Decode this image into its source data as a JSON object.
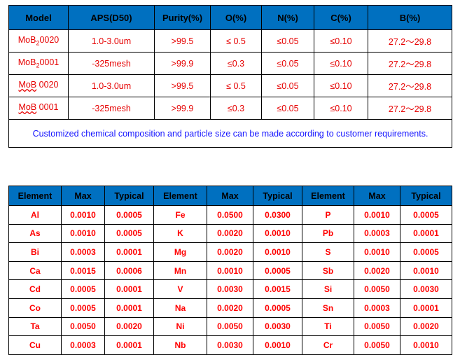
{
  "colors": {
    "header_blue": "#0070C0",
    "data_red": "#FF0000",
    "note_blue": "#1414FF",
    "border": "#000000"
  },
  "spec_table": {
    "name": "product-specification-table",
    "columns": [
      "Model",
      "APS(D50)",
      "Purity(%)",
      "O(%)",
      "N(%)",
      "C(%)",
      "B(%)"
    ],
    "rows": [
      {
        "model_prefix": "MoB",
        "model_sub": "2",
        "model_suffix": "0020",
        "model_misspelled": false,
        "aps": "1.0-3.0um",
        "purity": ">99.5",
        "o": "≤ 0.5",
        "n": "≤0.05",
        "c": "≤0.10",
        "b": "27.2～29.8"
      },
      {
        "model_prefix": "MoB",
        "model_sub": "2",
        "model_suffix": "0001",
        "model_misspelled": false,
        "aps": "-325mesh",
        "purity": ">99.9",
        "o": "≤0.3",
        "n": "≤0.05",
        "c": "≤0.10",
        "b": "27.2～29.8"
      },
      {
        "model_prefix": "MoB",
        "model_sub": "",
        "model_suffix": " 0020",
        "model_misspelled": true,
        "aps": "1.0-3.0um",
        "purity": ">99.5",
        "o": "≤ 0.5",
        "n": "≤0.05",
        "c": "≤0.10",
        "b": "27.2～29.8"
      },
      {
        "model_prefix": "MoB",
        "model_sub": "",
        "model_suffix": " 0001",
        "model_misspelled": true,
        "aps": "-325mesh",
        "purity": ">99.9",
        "o": "≤0.3",
        "n": "≤0.05",
        "c": "≤0.10",
        "b": "27.2～29.8"
      }
    ],
    "note": "Customized chemical composition and particle size can be made according to customer requirements."
  },
  "impurity_table": {
    "name": "impurity-analysis-table",
    "columns": [
      "Element",
      "Max",
      "Typical",
      "Element",
      "Max",
      "Typical",
      "Element",
      "Max",
      "Typical"
    ],
    "rows": [
      [
        "Al",
        "0.0010",
        "0.0005",
        "Fe",
        "0.0500",
        "0.0300",
        "P",
        "0.0010",
        "0.0005"
      ],
      [
        "As",
        "0.0010",
        "0.0005",
        "K",
        "0.0020",
        "0.0010",
        "Pb",
        "0.0003",
        "0.0001"
      ],
      [
        "Bi",
        "0.0003",
        "0.0001",
        "Mg",
        "0.0020",
        "0.0010",
        "S",
        "0.0010",
        "0.0005"
      ],
      [
        "Ca",
        "0.0015",
        "0.0006",
        "Mn",
        "0.0010",
        "0.0005",
        "Sb",
        "0.0020",
        "0.0010"
      ],
      [
        "Cd",
        "0.0005",
        "0.0001",
        "V",
        "0.0030",
        "0.0015",
        "Si",
        "0.0050",
        "0.0030"
      ],
      [
        "Co",
        "0.0005",
        "0.0001",
        "Na",
        "0.0020",
        "0.0005",
        "Sn",
        "0.0003",
        "0.0001"
      ],
      [
        "Ta",
        "0.0050",
        "0.0020",
        "Ni",
        "0.0050",
        "0.0030",
        "Ti",
        "0.0050",
        "0.0020"
      ],
      [
        "Cu",
        "0.0003",
        "0.0001",
        "Nb",
        "0.0030",
        "0.0010",
        "Cr",
        "0.0050",
        "0.0010"
      ]
    ]
  }
}
